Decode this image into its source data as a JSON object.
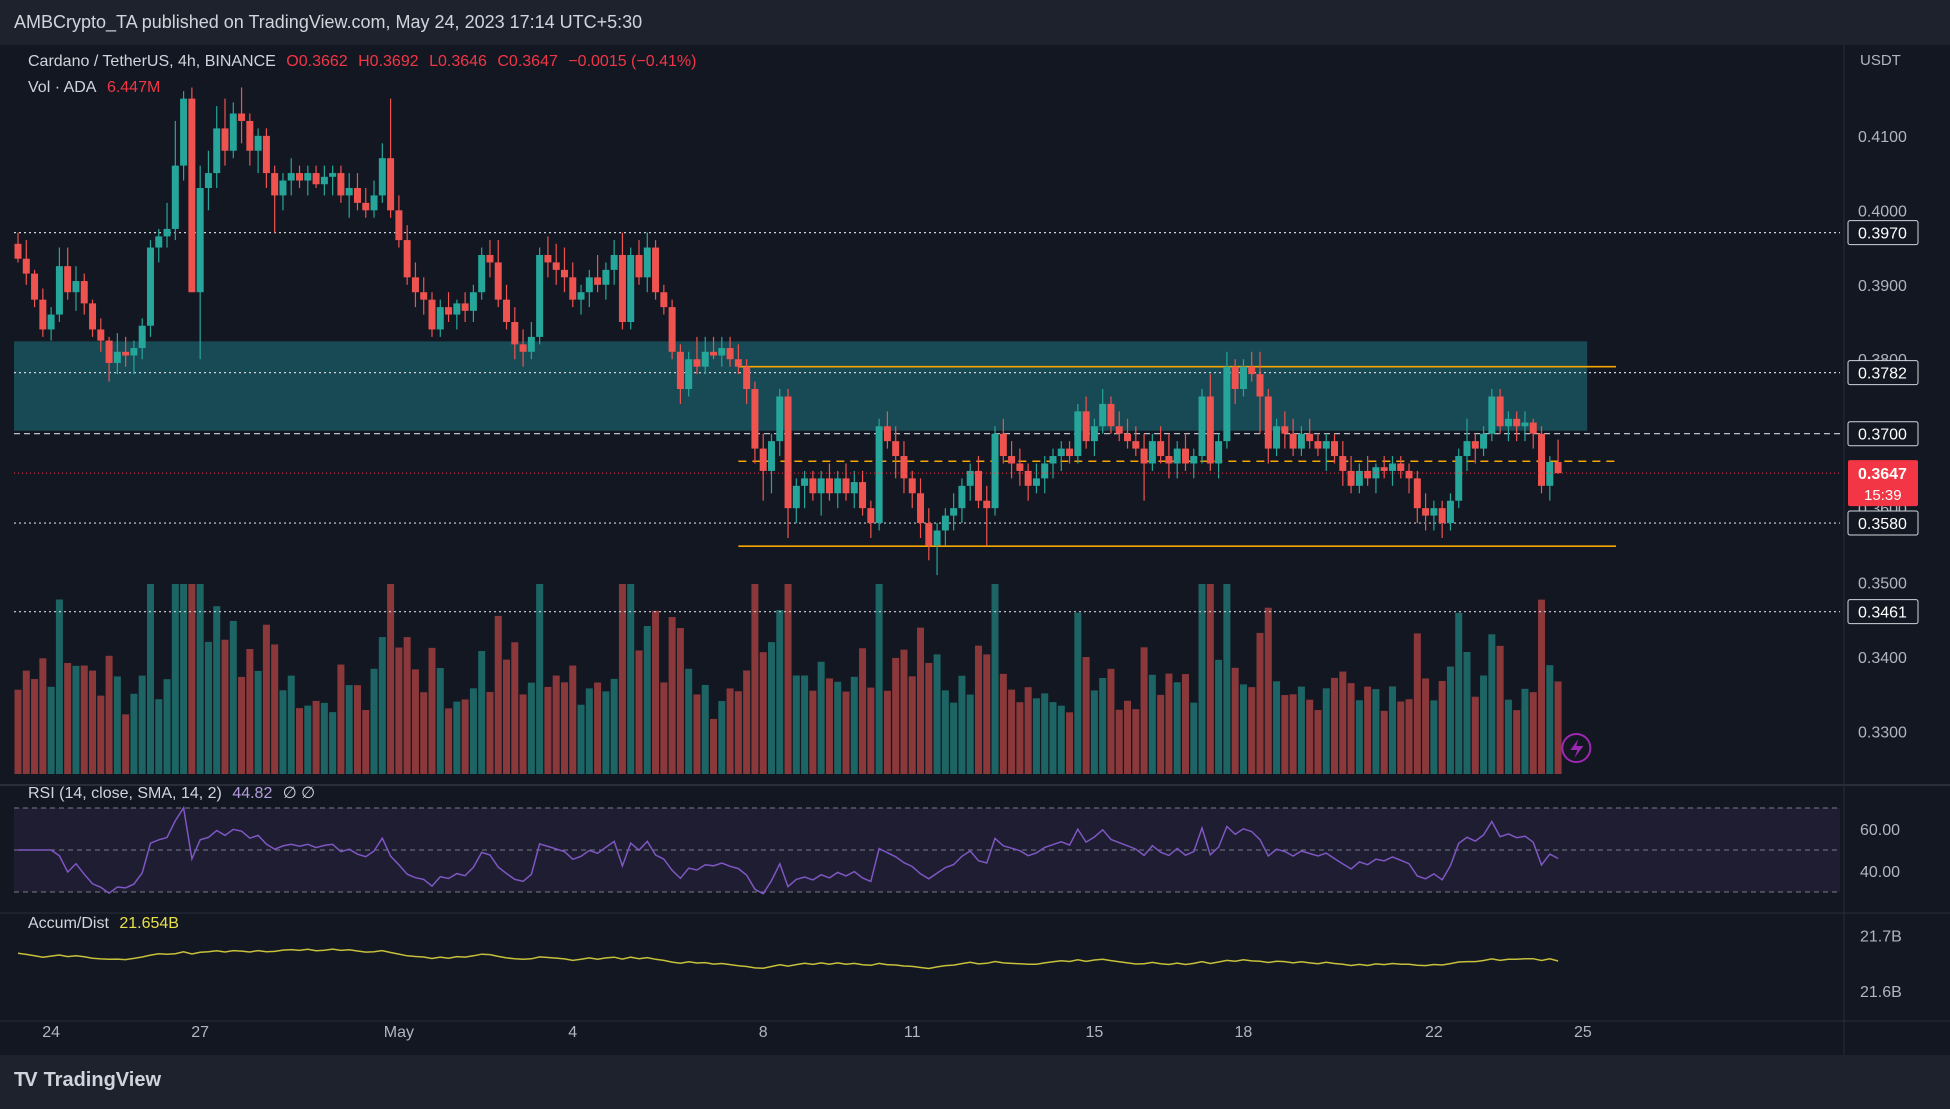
{
  "publish_bar": {
    "author": "AMBCrypto_TA",
    "text": "AMBCrypto_TA published on TradingView.com, May 24, 2023 17:14 UTC+5:30"
  },
  "legend": {
    "symbol": "Cardano / TetherUS, 4h, BINANCE",
    "open": "O0.3662",
    "high": "H0.3692",
    "low": "L0.3646",
    "close": "C0.3647",
    "change": "−0.0015 (−0.41%)",
    "vol_label": "Vol · ADA",
    "vol_value": "6.447M",
    "rsi_label": "RSI (14, close, SMA, 14, 2)",
    "rsi_value": "44.82",
    "rsi_na": "∅  ∅",
    "ad_label": "Accum/Dist",
    "ad_value": "21.654B"
  },
  "currency_label": "USDT",
  "footer": {
    "brand": "TradingView"
  },
  "colors": {
    "bull": "#26a69a",
    "bear": "#ef5350",
    "zone": "#1a5c66",
    "orange": "#f7a600",
    "rsi": "#7e57c2",
    "ad": "#c6c03a",
    "price_tag": "#f23645"
  },
  "chart_data": {
    "type": "candlestick",
    "symbol": "Cardano / TetherUS",
    "interval": "4h",
    "exchange": "BINANCE",
    "price_axis": {
      "ticks": [
        "0.4100",
        "0.4000",
        "0.3900",
        "0.3800",
        "0.3700",
        "0.3600",
        "0.3500",
        "0.3400",
        "0.3300"
      ],
      "tick_values": [
        0.41,
        0.4,
        0.39,
        0.38,
        0.37,
        0.36,
        0.35,
        0.34,
        0.33
      ],
      "range": [
        0.3243,
        0.4222
      ]
    },
    "x_axis": {
      "labels": [
        "24",
        "27",
        "May",
        "4",
        "8",
        "11",
        "15",
        "18",
        "22",
        "25"
      ],
      "bar_index": [
        4,
        22,
        46,
        67,
        90,
        108,
        130,
        148,
        171,
        189
      ]
    },
    "horizontal_levels": [
      {
        "label": "0.3970",
        "value": 0.397,
        "style": "dotted-white"
      },
      {
        "label": "0.3782",
        "value": 0.3782,
        "style": "dotted-white"
      },
      {
        "label": "0.3700",
        "value": 0.37,
        "style": "dashed-white"
      },
      {
        "label": "0.3580",
        "value": 0.358,
        "style": "dotted-white"
      },
      {
        "label": "0.3461",
        "value": 0.3461,
        "style": "dotted-white"
      }
    ],
    "range_lines": [
      {
        "value": 0.379,
        "style": "solid-orange",
        "from_bar": 87,
        "to_bar": 193
      },
      {
        "value": 0.3663,
        "style": "dashed-orange",
        "from_bar": 87,
        "to_bar": 193
      },
      {
        "value": 0.3549,
        "style": "solid-orange",
        "from_bar": 87,
        "to_bar": 193
      }
    ],
    "supply_zone": {
      "top": 0.3824,
      "bottom": 0.3704,
      "from_bar": 0,
      "to_bar": 190
    },
    "last_price": {
      "label": "0.3647",
      "countdown": "15:39",
      "value": 0.3647
    },
    "rsi": {
      "ticks": [
        "60.00",
        "40.00"
      ],
      "tick_values": [
        60,
        40
      ],
      "band": [
        30,
        70
      ],
      "range": [
        20,
        80
      ],
      "current": 44.82
    },
    "accum_dist": {
      "ticks": [
        "21.7B",
        "21.6B"
      ],
      "tick_values": [
        21.7,
        21.6
      ],
      "range": [
        21.55,
        21.74
      ],
      "current": 21.654
    },
    "volume": {
      "range": [
        0,
        20
      ]
    },
    "candles": [
      [
        0.3955,
        0.397,
        0.393,
        0.3935
      ],
      [
        0.3935,
        0.396,
        0.39,
        0.3915
      ],
      [
        0.3915,
        0.392,
        0.387,
        0.388
      ],
      [
        0.388,
        0.3895,
        0.383,
        0.384
      ],
      [
        0.384,
        0.387,
        0.3825,
        0.386
      ],
      [
        0.386,
        0.395,
        0.385,
        0.3925
      ],
      [
        0.3925,
        0.395,
        0.388,
        0.389
      ],
      [
        0.389,
        0.3925,
        0.3865,
        0.3905
      ],
      [
        0.3905,
        0.3915,
        0.386,
        0.3875
      ],
      [
        0.3875,
        0.388,
        0.383,
        0.384
      ],
      [
        0.384,
        0.3855,
        0.381,
        0.3825
      ],
      [
        0.3825,
        0.383,
        0.377,
        0.3795
      ],
      [
        0.3795,
        0.3835,
        0.378,
        0.381
      ],
      [
        0.381,
        0.383,
        0.379,
        0.3805
      ],
      [
        0.3805,
        0.3825,
        0.378,
        0.3815
      ],
      [
        0.3815,
        0.3855,
        0.38,
        0.3845
      ],
      [
        0.3845,
        0.396,
        0.383,
        0.395
      ],
      [
        0.395,
        0.3975,
        0.393,
        0.3965
      ],
      [
        0.3965,
        0.401,
        0.395,
        0.3975
      ],
      [
        0.3975,
        0.412,
        0.396,
        0.406
      ],
      [
        0.406,
        0.416,
        0.404,
        0.415
      ],
      [
        0.415,
        0.4165,
        0.389,
        0.389
      ],
      [
        0.389,
        0.406,
        0.38,
        0.403
      ],
      [
        0.403,
        0.408,
        0.4,
        0.405
      ],
      [
        0.405,
        0.414,
        0.403,
        0.411
      ],
      [
        0.411,
        0.415,
        0.406,
        0.408
      ],
      [
        0.408,
        0.4145,
        0.407,
        0.413
      ],
      [
        0.413,
        0.4165,
        0.409,
        0.412
      ],
      [
        0.412,
        0.413,
        0.406,
        0.408
      ],
      [
        0.408,
        0.411,
        0.405,
        0.41
      ],
      [
        0.41,
        0.411,
        0.403,
        0.405
      ],
      [
        0.405,
        0.406,
        0.397,
        0.402
      ],
      [
        0.402,
        0.405,
        0.4,
        0.404
      ],
      [
        0.404,
        0.407,
        0.402,
        0.405
      ],
      [
        0.405,
        0.406,
        0.403,
        0.404
      ],
      [
        0.404,
        0.406,
        0.402,
        0.405
      ],
      [
        0.405,
        0.406,
        0.403,
        0.4035
      ],
      [
        0.4035,
        0.406,
        0.402,
        0.4045
      ],
      [
        0.4045,
        0.406,
        0.402,
        0.405
      ],
      [
        0.405,
        0.406,
        0.401,
        0.402
      ],
      [
        0.402,
        0.405,
        0.399,
        0.403
      ],
      [
        0.403,
        0.405,
        0.4,
        0.401
      ],
      [
        0.401,
        0.403,
        0.399,
        0.4
      ],
      [
        0.4,
        0.404,
        0.399,
        0.402
      ],
      [
        0.402,
        0.409,
        0.401,
        0.407
      ],
      [
        0.407,
        0.415,
        0.399,
        0.4
      ],
      [
        0.4,
        0.402,
        0.395,
        0.396
      ],
      [
        0.396,
        0.398,
        0.39,
        0.391
      ],
      [
        0.391,
        0.393,
        0.387,
        0.389
      ],
      [
        0.389,
        0.391,
        0.386,
        0.388
      ],
      [
        0.388,
        0.389,
        0.383,
        0.384
      ],
      [
        0.384,
        0.388,
        0.383,
        0.387
      ],
      [
        0.387,
        0.389,
        0.385,
        0.386
      ],
      [
        0.386,
        0.388,
        0.384,
        0.3875
      ],
      [
        0.3875,
        0.389,
        0.385,
        0.3865
      ],
      [
        0.3865,
        0.39,
        0.385,
        0.389
      ],
      [
        0.389,
        0.395,
        0.388,
        0.394
      ],
      [
        0.394,
        0.396,
        0.391,
        0.393
      ],
      [
        0.393,
        0.396,
        0.387,
        0.388
      ],
      [
        0.388,
        0.39,
        0.384,
        0.385
      ],
      [
        0.385,
        0.387,
        0.38,
        0.382
      ],
      [
        0.382,
        0.384,
        0.379,
        0.381
      ],
      [
        0.381,
        0.385,
        0.38,
        0.383
      ],
      [
        0.383,
        0.395,
        0.382,
        0.394
      ],
      [
        0.394,
        0.3965,
        0.391,
        0.393
      ],
      [
        0.393,
        0.3955,
        0.39,
        0.392
      ],
      [
        0.392,
        0.395,
        0.389,
        0.391
      ],
      [
        0.391,
        0.393,
        0.387,
        0.388
      ],
      [
        0.388,
        0.39,
        0.386,
        0.389
      ],
      [
        0.389,
        0.392,
        0.387,
        0.391
      ],
      [
        0.391,
        0.394,
        0.389,
        0.39
      ],
      [
        0.39,
        0.393,
        0.388,
        0.392
      ],
      [
        0.392,
        0.396,
        0.39,
        0.394
      ],
      [
        0.394,
        0.397,
        0.384,
        0.385
      ],
      [
        0.385,
        0.395,
        0.384,
        0.394
      ],
      [
        0.394,
        0.396,
        0.39,
        0.391
      ],
      [
        0.391,
        0.397,
        0.389,
        0.395
      ],
      [
        0.395,
        0.396,
        0.388,
        0.389
      ],
      [
        0.389,
        0.39,
        0.386,
        0.387
      ],
      [
        0.387,
        0.388,
        0.38,
        0.381
      ],
      [
        0.381,
        0.382,
        0.374,
        0.376
      ],
      [
        0.376,
        0.381,
        0.375,
        0.38
      ],
      [
        0.38,
        0.383,
        0.378,
        0.379
      ],
      [
        0.379,
        0.383,
        0.378,
        0.381
      ],
      [
        0.381,
        0.383,
        0.38,
        0.3805
      ],
      [
        0.3805,
        0.383,
        0.379,
        0.3815
      ],
      [
        0.3815,
        0.383,
        0.379,
        0.38
      ],
      [
        0.38,
        0.382,
        0.378,
        0.379
      ],
      [
        0.379,
        0.38,
        0.374,
        0.376
      ],
      [
        0.376,
        0.377,
        0.366,
        0.368
      ],
      [
        0.368,
        0.37,
        0.361,
        0.365
      ],
      [
        0.365,
        0.37,
        0.362,
        0.369
      ],
      [
        0.369,
        0.376,
        0.367,
        0.375
      ],
      [
        0.375,
        0.376,
        0.356,
        0.36
      ],
      [
        0.36,
        0.364,
        0.358,
        0.363
      ],
      [
        0.363,
        0.365,
        0.36,
        0.364
      ],
      [
        0.364,
        0.365,
        0.361,
        0.362
      ],
      [
        0.362,
        0.365,
        0.359,
        0.364
      ],
      [
        0.364,
        0.366,
        0.361,
        0.362
      ],
      [
        0.362,
        0.365,
        0.36,
        0.364
      ],
      [
        0.364,
        0.366,
        0.361,
        0.362
      ],
      [
        0.362,
        0.365,
        0.36,
        0.3635
      ],
      [
        0.3635,
        0.365,
        0.359,
        0.36
      ],
      [
        0.36,
        0.361,
        0.356,
        0.358
      ],
      [
        0.358,
        0.372,
        0.357,
        0.371
      ],
      [
        0.371,
        0.373,
        0.368,
        0.369
      ],
      [
        0.369,
        0.371,
        0.364,
        0.367
      ],
      [
        0.367,
        0.369,
        0.362,
        0.364
      ],
      [
        0.364,
        0.365,
        0.36,
        0.362
      ],
      [
        0.362,
        0.364,
        0.356,
        0.358
      ],
      [
        0.358,
        0.36,
        0.353,
        0.355
      ],
      [
        0.355,
        0.358,
        0.351,
        0.357
      ],
      [
        0.357,
        0.36,
        0.355,
        0.359
      ],
      [
        0.359,
        0.362,
        0.357,
        0.36
      ],
      [
        0.36,
        0.364,
        0.358,
        0.363
      ],
      [
        0.363,
        0.366,
        0.361,
        0.365
      ],
      [
        0.365,
        0.367,
        0.36,
        0.361
      ],
      [
        0.361,
        0.363,
        0.355,
        0.36
      ],
      [
        0.36,
        0.371,
        0.359,
        0.37
      ],
      [
        0.37,
        0.372,
        0.366,
        0.367
      ],
      [
        0.367,
        0.369,
        0.364,
        0.366
      ],
      [
        0.366,
        0.368,
        0.363,
        0.365
      ],
      [
        0.365,
        0.366,
        0.361,
        0.363
      ],
      [
        0.363,
        0.366,
        0.362,
        0.364
      ],
      [
        0.364,
        0.367,
        0.362,
        0.366
      ],
      [
        0.366,
        0.368,
        0.364,
        0.367
      ],
      [
        0.367,
        0.369,
        0.365,
        0.368
      ],
      [
        0.368,
        0.369,
        0.366,
        0.367
      ],
      [
        0.367,
        0.374,
        0.366,
        0.373
      ],
      [
        0.373,
        0.375,
        0.368,
        0.369
      ],
      [
        0.369,
        0.372,
        0.367,
        0.371
      ],
      [
        0.371,
        0.376,
        0.37,
        0.374
      ],
      [
        0.374,
        0.375,
        0.37,
        0.371
      ],
      [
        0.371,
        0.373,
        0.369,
        0.37
      ],
      [
        0.37,
        0.372,
        0.368,
        0.369
      ],
      [
        0.369,
        0.371,
        0.367,
        0.368
      ],
      [
        0.368,
        0.37,
        0.361,
        0.366
      ],
      [
        0.366,
        0.37,
        0.365,
        0.369
      ],
      [
        0.369,
        0.371,
        0.366,
        0.367
      ],
      [
        0.367,
        0.37,
        0.364,
        0.366
      ],
      [
        0.366,
        0.369,
        0.364,
        0.368
      ],
      [
        0.368,
        0.37,
        0.365,
        0.366
      ],
      [
        0.366,
        0.368,
        0.364,
        0.367
      ],
      [
        0.367,
        0.376,
        0.366,
        0.375
      ],
      [
        0.375,
        0.378,
        0.365,
        0.366
      ],
      [
        0.366,
        0.37,
        0.364,
        0.369
      ],
      [
        0.369,
        0.381,
        0.368,
        0.379
      ],
      [
        0.379,
        0.38,
        0.374,
        0.376
      ],
      [
        0.376,
        0.38,
        0.375,
        0.379
      ],
      [
        0.379,
        0.381,
        0.377,
        0.378
      ],
      [
        0.378,
        0.381,
        0.37,
        0.375
      ],
      [
        0.375,
        0.376,
        0.366,
        0.368
      ],
      [
        0.368,
        0.372,
        0.367,
        0.371
      ],
      [
        0.371,
        0.373,
        0.368,
        0.37
      ],
      [
        0.37,
        0.372,
        0.367,
        0.368
      ],
      [
        0.368,
        0.371,
        0.367,
        0.37
      ],
      [
        0.37,
        0.372,
        0.368,
        0.369
      ],
      [
        0.369,
        0.37,
        0.367,
        0.368
      ],
      [
        0.368,
        0.37,
        0.365,
        0.369
      ],
      [
        0.369,
        0.37,
        0.366,
        0.367
      ],
      [
        0.367,
        0.369,
        0.363,
        0.365
      ],
      [
        0.365,
        0.367,
        0.362,
        0.363
      ],
      [
        0.363,
        0.366,
        0.362,
        0.365
      ],
      [
        0.365,
        0.367,
        0.363,
        0.364
      ],
      [
        0.364,
        0.366,
        0.362,
        0.3655
      ],
      [
        0.3655,
        0.367,
        0.364,
        0.365
      ],
      [
        0.365,
        0.367,
        0.363,
        0.366
      ],
      [
        0.366,
        0.367,
        0.364,
        0.365
      ],
      [
        0.365,
        0.366,
        0.362,
        0.364
      ],
      [
        0.364,
        0.365,
        0.358,
        0.36
      ],
      [
        0.36,
        0.362,
        0.357,
        0.359
      ],
      [
        0.359,
        0.361,
        0.357,
        0.36
      ],
      [
        0.36,
        0.361,
        0.356,
        0.358
      ],
      [
        0.358,
        0.362,
        0.357,
        0.361
      ],
      [
        0.361,
        0.368,
        0.36,
        0.367
      ],
      [
        0.367,
        0.372,
        0.365,
        0.369
      ],
      [
        0.369,
        0.37,
        0.366,
        0.368
      ],
      [
        0.368,
        0.371,
        0.367,
        0.37
      ],
      [
        0.37,
        0.376,
        0.369,
        0.375
      ],
      [
        0.375,
        0.376,
        0.37,
        0.371
      ],
      [
        0.371,
        0.373,
        0.369,
        0.372
      ],
      [
        0.372,
        0.373,
        0.369,
        0.371
      ],
      [
        0.371,
        0.373,
        0.369,
        0.3715
      ],
      [
        0.3715,
        0.372,
        0.368,
        0.37
      ],
      [
        0.37,
        0.371,
        0.362,
        0.363
      ],
      [
        0.363,
        0.367,
        0.361,
        0.3662
      ],
      [
        0.3662,
        0.3692,
        0.3646,
        0.3647
      ]
    ]
  }
}
